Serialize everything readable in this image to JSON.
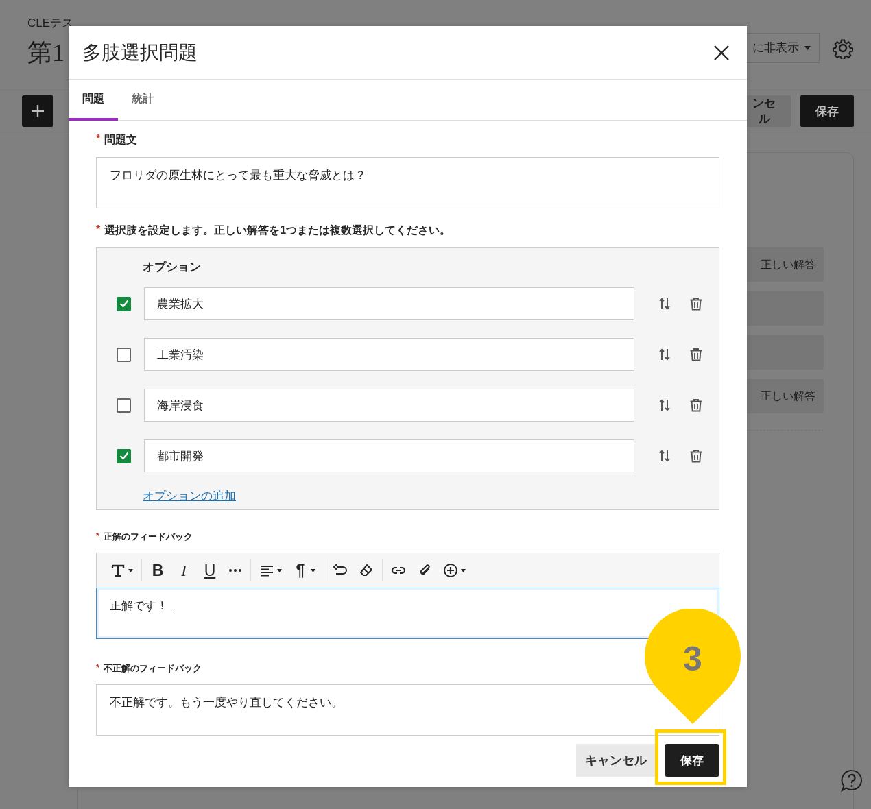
{
  "background": {
    "course": "CLEテス",
    "title": "第1",
    "visibility": "に非表示",
    "cancel": "ンセル",
    "save": "保存",
    "rows": [
      {
        "kind": "labeled",
        "label": "正しい解答"
      },
      {
        "kind": "blank"
      },
      {
        "kind": "blank"
      },
      {
        "kind": "labeled",
        "label": "正しい解答"
      }
    ]
  },
  "dialog": {
    "title": "多肢選択問題",
    "tabs": [
      {
        "label": "問題",
        "selected": true
      },
      {
        "label": "統計",
        "selected": false
      }
    ],
    "question": {
      "mark": "*",
      "label": "問題文",
      "value": "フロリダの原生林にとって最も重大な脅威とは？"
    },
    "options_prompt": {
      "mark": "*",
      "label": "選択肢を設定します。正しい解答を1つまたは複数選択してください。"
    },
    "options_heading": "オプション",
    "options": [
      {
        "text": "農業拡大",
        "checked": true
      },
      {
        "text": "工業汚染",
        "checked": false
      },
      {
        "text": "海岸浸食",
        "checked": false
      },
      {
        "text": "都市開発",
        "checked": true
      }
    ],
    "add_option": "オプションの追加",
    "correct_feedback": {
      "mark": "*",
      "label": "正解のフィードバック",
      "value": "正解です！",
      "focused": true
    },
    "toolbar": [
      [
        {
          "kind": "text",
          "menu": true
        }
      ],
      [
        {
          "kind": "bold",
          "glyph": "B"
        },
        {
          "kind": "italic",
          "glyph": "I"
        },
        {
          "kind": "underline",
          "glyph": "U"
        },
        {
          "kind": "more"
        }
      ],
      [
        {
          "kind": "align",
          "menu": true
        },
        {
          "kind": "paragraph",
          "glyph": "¶",
          "menu": true
        }
      ],
      [
        {
          "kind": "undo"
        },
        {
          "kind": "eraser"
        }
      ],
      [
        {
          "kind": "link"
        },
        {
          "kind": "attach"
        },
        {
          "kind": "insert",
          "menu": true
        }
      ]
    ],
    "incorrect_feedback": {
      "mark": "*",
      "label": "不正解のフィードバック",
      "value": "不正解です。もう一度やり直してください。",
      "focused": false
    },
    "cancel": "キャンセル",
    "save": "保存"
  },
  "callout": {
    "number": "3"
  }
}
